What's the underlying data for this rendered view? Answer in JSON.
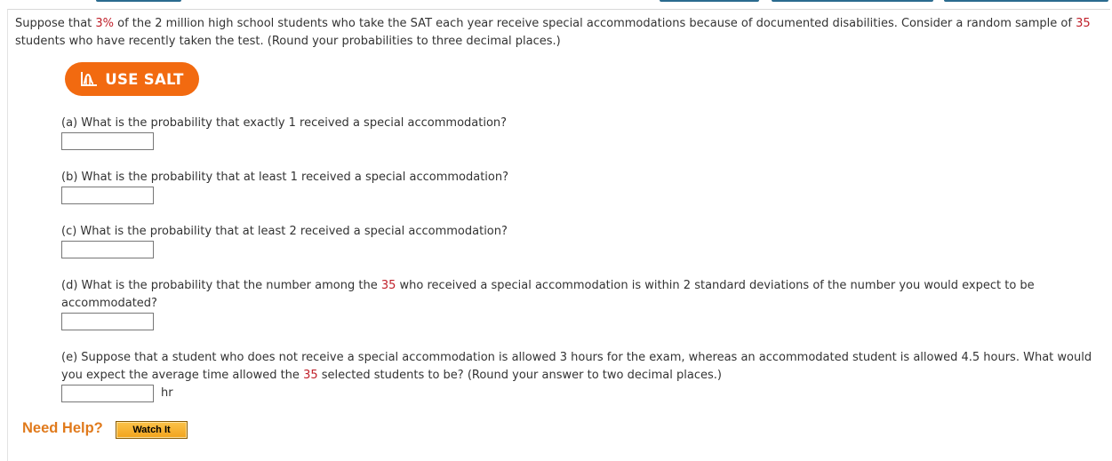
{
  "intro": {
    "p1": "Suppose that ",
    "pct": "3%",
    "p2": " of the 2 million high school students who take the SAT each year receive special accommodations because of documented disabilities. Consider a random sample of ",
    "n": "35",
    "p3": " students who have recently taken the test. (Round your probabilities to three decimal places.)"
  },
  "salt": {
    "label": "USE SALT"
  },
  "questions": {
    "a": {
      "text": "(a) What is the probability that exactly 1 received a special accommodation?"
    },
    "b": {
      "text": "(b) What is the probability that at least 1 received a special accommodation?"
    },
    "c": {
      "text": "(c) What is the probability that at least 2 received a special accommodation?"
    },
    "d": {
      "t1": "(d) What is the probability that the number among the ",
      "n": "35",
      "t2": " who received a special accommodation is within 2 standard deviations of the number you would expect to be accommodated?"
    },
    "e": {
      "t1": "(e) Suppose that a student who does not receive a special accommodation is allowed 3 hours for the exam, whereas an accommodated student is allowed 4.5 hours. What would you expect the average time allowed the ",
      "n": "35",
      "t2": " selected students to be? (Round your answer to two decimal places.)",
      "unit": "hr"
    }
  },
  "help": {
    "label": "Need Help?",
    "watch": "Watch It"
  },
  "colors": {
    "accent": "#f26a10",
    "highlight": "#c0202a",
    "help": "#e07a1c"
  }
}
